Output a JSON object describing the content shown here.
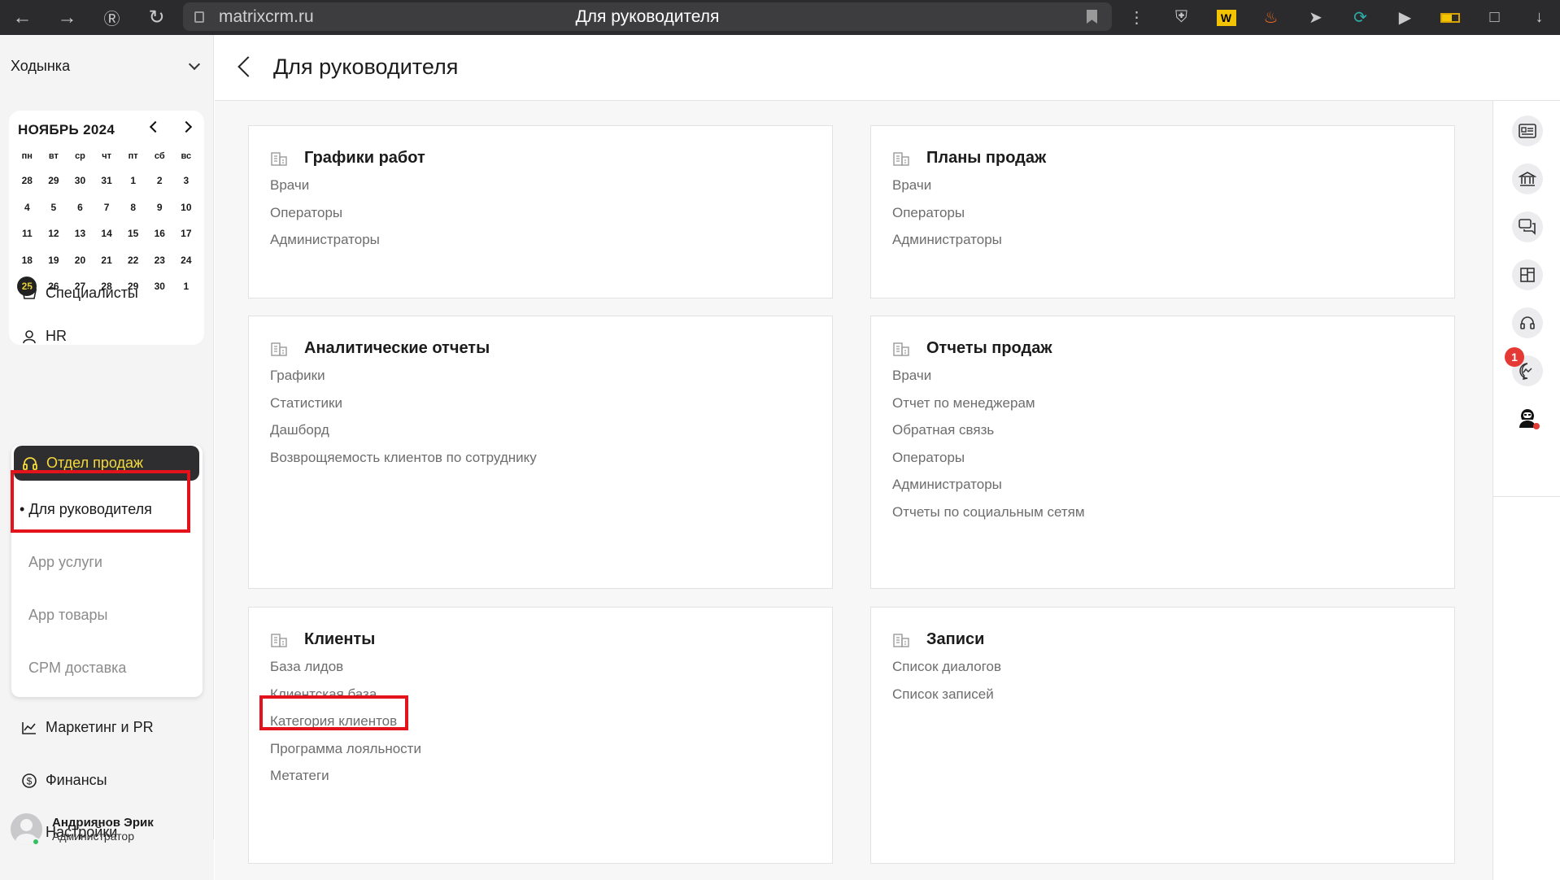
{
  "browser": {
    "url": "matrixcrm.ru",
    "tab_title": "Для руководителя"
  },
  "sidebar": {
    "branch": "Ходынка",
    "calendar": {
      "month_label": "НОЯБРЬ 2024",
      "weekdays": [
        "пн",
        "вт",
        "ср",
        "чт",
        "пт",
        "сб",
        "вс"
      ],
      "days": [
        "28",
        "29",
        "30",
        "31",
        "1",
        "2",
        "3",
        "4",
        "5",
        "6",
        "7",
        "8",
        "9",
        "10",
        "11",
        "12",
        "13",
        "14",
        "15",
        "16",
        "17",
        "18",
        "19",
        "20",
        "21",
        "22",
        "23",
        "24",
        "25",
        "26",
        "27",
        "28",
        "29",
        "30",
        "1"
      ],
      "today": "25"
    },
    "nav": {
      "specialists": "Специалисты",
      "hr": "HR",
      "sales": "Отдел продаж",
      "marketing": "Маркетинг и PR",
      "finance": "Финансы",
      "settings": "Настройки"
    },
    "sales_sub": {
      "for_manager": "Для руководителя",
      "app_services": "App услуги",
      "app_goods": "App товары",
      "crm_delivery": "CPM доставка"
    },
    "user": {
      "name": "Андриянов Эрик",
      "role": "Администратор"
    }
  },
  "header": {
    "title": "Для руководителя"
  },
  "cards": {
    "schedules": {
      "title": "Графики работ",
      "links": [
        "Врачи",
        "Операторы",
        "Администраторы"
      ]
    },
    "sales_plans": {
      "title": "Планы продаж",
      "links": [
        "Врачи",
        "Операторы",
        "Администраторы"
      ]
    },
    "analytics": {
      "title": "Аналитические отчеты",
      "links": [
        "Графики",
        "Статистики",
        "Дашборд",
        "Возврощяемость клиентов по сотруднику"
      ]
    },
    "sales_reports": {
      "title": "Отчеты продаж",
      "links": [
        "Врачи",
        "Отчет по менеджерам",
        "Обратная связь",
        "Операторы",
        "Администраторы",
        "Отчеты по социальным сетям"
      ]
    },
    "clients": {
      "title": "Клиенты",
      "links": [
        "База лидов",
        "Клиентская база",
        "Категория клиентов",
        "Программа лояльности",
        "Метатеги"
      ]
    },
    "records": {
      "title": "Записи",
      "links": [
        "Список диалогов",
        "Список записей"
      ]
    }
  },
  "rail": {
    "messages_badge": "1"
  },
  "colors": {
    "accent_yellow": "#f3d93b",
    "highlight_red": "#e3131b",
    "badge_red": "#e53935"
  }
}
